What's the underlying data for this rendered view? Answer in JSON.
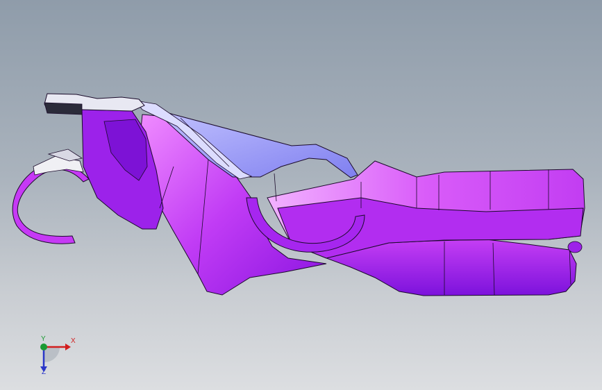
{
  "window": {
    "type": "3d-cad-viewport",
    "background_top": "#8f9caa",
    "background_bottom": "#dcdee1"
  },
  "model": {
    "part": "stamped-sheet-metal-bracket",
    "surface_color": "#b020f0",
    "highlight_color": "#e070ff",
    "flange_color": "#9a9af8",
    "edge_color": "#1a0a2a"
  },
  "triad": {
    "x_label": "X",
    "y_label": "Y",
    "z_label": "Z",
    "x_color": "#d21e1e",
    "y_color": "#1b9a33",
    "z_color": "#2a36c8"
  }
}
